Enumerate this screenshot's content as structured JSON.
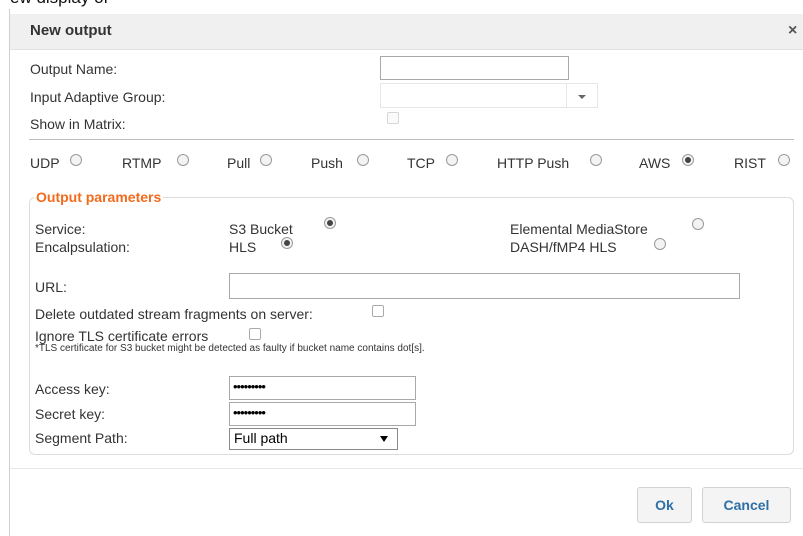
{
  "top_clip_text": "ew display of",
  "dialog": {
    "title": "New output",
    "close_symbol": "×"
  },
  "form": {
    "output_name_label": "Output Name:",
    "output_name_value": "",
    "input_adaptive_group_label": "Input Adaptive Group:",
    "input_adaptive_group_value": "",
    "show_in_matrix_label": "Show in Matrix:",
    "show_in_matrix_checked": false
  },
  "protocols": [
    {
      "label": "UDP",
      "selected": false
    },
    {
      "label": "RTMP",
      "selected": false
    },
    {
      "label": "Pull",
      "selected": false
    },
    {
      "label": "Push",
      "selected": false
    },
    {
      "label": "TCP",
      "selected": false
    },
    {
      "label": "HTTP Push",
      "selected": false
    },
    {
      "label": "AWS",
      "selected": true
    },
    {
      "label": "RIST",
      "selected": false
    }
  ],
  "output_parameters": {
    "legend": "Output parameters",
    "service_label": "Service:",
    "service_options": [
      {
        "label": "S3 Bucket",
        "selected": true
      },
      {
        "label": "Elemental MediaStore",
        "selected": false
      }
    ],
    "encapsulation_label": "Encalpsulation:",
    "encapsulation_options": [
      {
        "label": "HLS",
        "selected": true
      },
      {
        "label": "DASH/fMP4 HLS",
        "selected": false
      }
    ],
    "url_label": "URL:",
    "url_value": "",
    "delete_fragments_label": "Delete outdated stream fragments on server:",
    "delete_fragments_checked": false,
    "ignore_tls_label": "Ignore TLS certificate errors",
    "ignore_tls_checked": false,
    "tls_note": "*TLS certificate for S3 bucket might be detected as faulty if bucket name contains dot[s].",
    "access_key_label": "Access key:",
    "access_key_value": "•••••••••",
    "secret_key_label": "Secret key:",
    "secret_key_value": "•••••••••",
    "segment_path_label": "Segment Path:",
    "segment_path_value": "Full path"
  },
  "buttons": {
    "ok": "Ok",
    "cancel": "Cancel"
  }
}
